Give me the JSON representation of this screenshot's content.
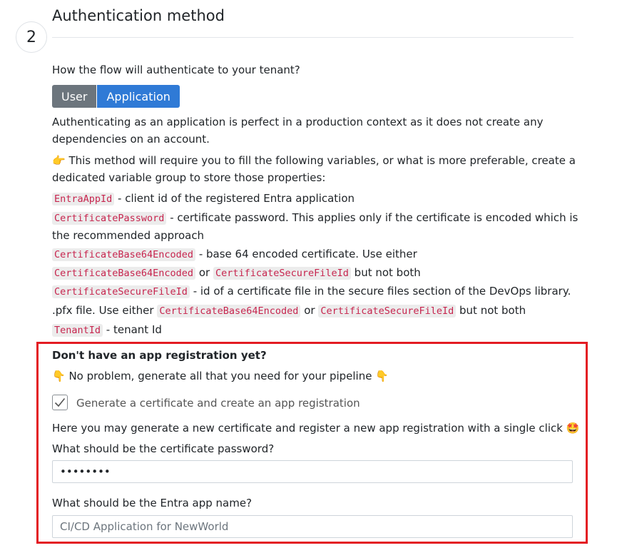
{
  "step": {
    "number": "2",
    "title": "Authentication method"
  },
  "question": "How the flow will authenticate to your tenant?",
  "toggle": {
    "user_label": "User",
    "application_label": "Application",
    "selected": "Application"
  },
  "description": {
    "line1": "Authenticating as an application is perfect in a production context as it does not create any",
    "line2": "dependencies on an account.",
    "pointer": "👉",
    "line3": " This method will require you to fill the following variables, or what is more preferable, create a",
    "line4": "dedicated variable group to store those properties:"
  },
  "variables": {
    "app_id_code": "EntraAppId",
    "app_id_text": " - client id of the registered Entra application",
    "cert_pwd_code": "CertificatePassword",
    "cert_pwd_text": " - certificate password. This applies only if the certificate is encoded which is",
    "cert_pwd_text2": "the recommended approach",
    "b64_code": "CertificateBase64Encoded",
    "b64_text": " - base 64 encoded certificate. Use either",
    "b64_code2": "CertificateBase64Encoded",
    "or1": " or ",
    "secure_code1": "CertificateSecureFileId",
    "but1": " but not both",
    "secure_code": "CertificateSecureFileId",
    "secure_text": " - id of a certificate file in the secure files section of the DevOps library.",
    "pfx_text": ".pfx file. Use either ",
    "b64_code3": "CertificateBase64Encoded",
    "or2": " or ",
    "secure_code2": "CertificateSecureFileId",
    "but2": " but not both",
    "tenant_code": "TenantId",
    "tenant_text": " - tenant Id"
  },
  "registration": {
    "heading": "Don't have an app registration yet?",
    "hand_emoji": "👇",
    "no_problem": " No problem, generate all that you need for your pipeline ",
    "checkbox_label": "Generate a certificate and create an app registration",
    "checkbox_checked": true,
    "info": "Here you may generate a new certificate and register a new app registration with a single click ",
    "star_emoji": "🤩",
    "password_label": "What should be the certificate password?",
    "password_value": "••••••••",
    "app_name_label": "What should be the Entra app name?",
    "app_name_placeholder": "CI/CD Application for NewWorld"
  },
  "colors": {
    "primary": "#2f7ad6",
    "secondary": "#6c757d",
    "highlight": "#e31b23",
    "code": "#c7254e"
  }
}
